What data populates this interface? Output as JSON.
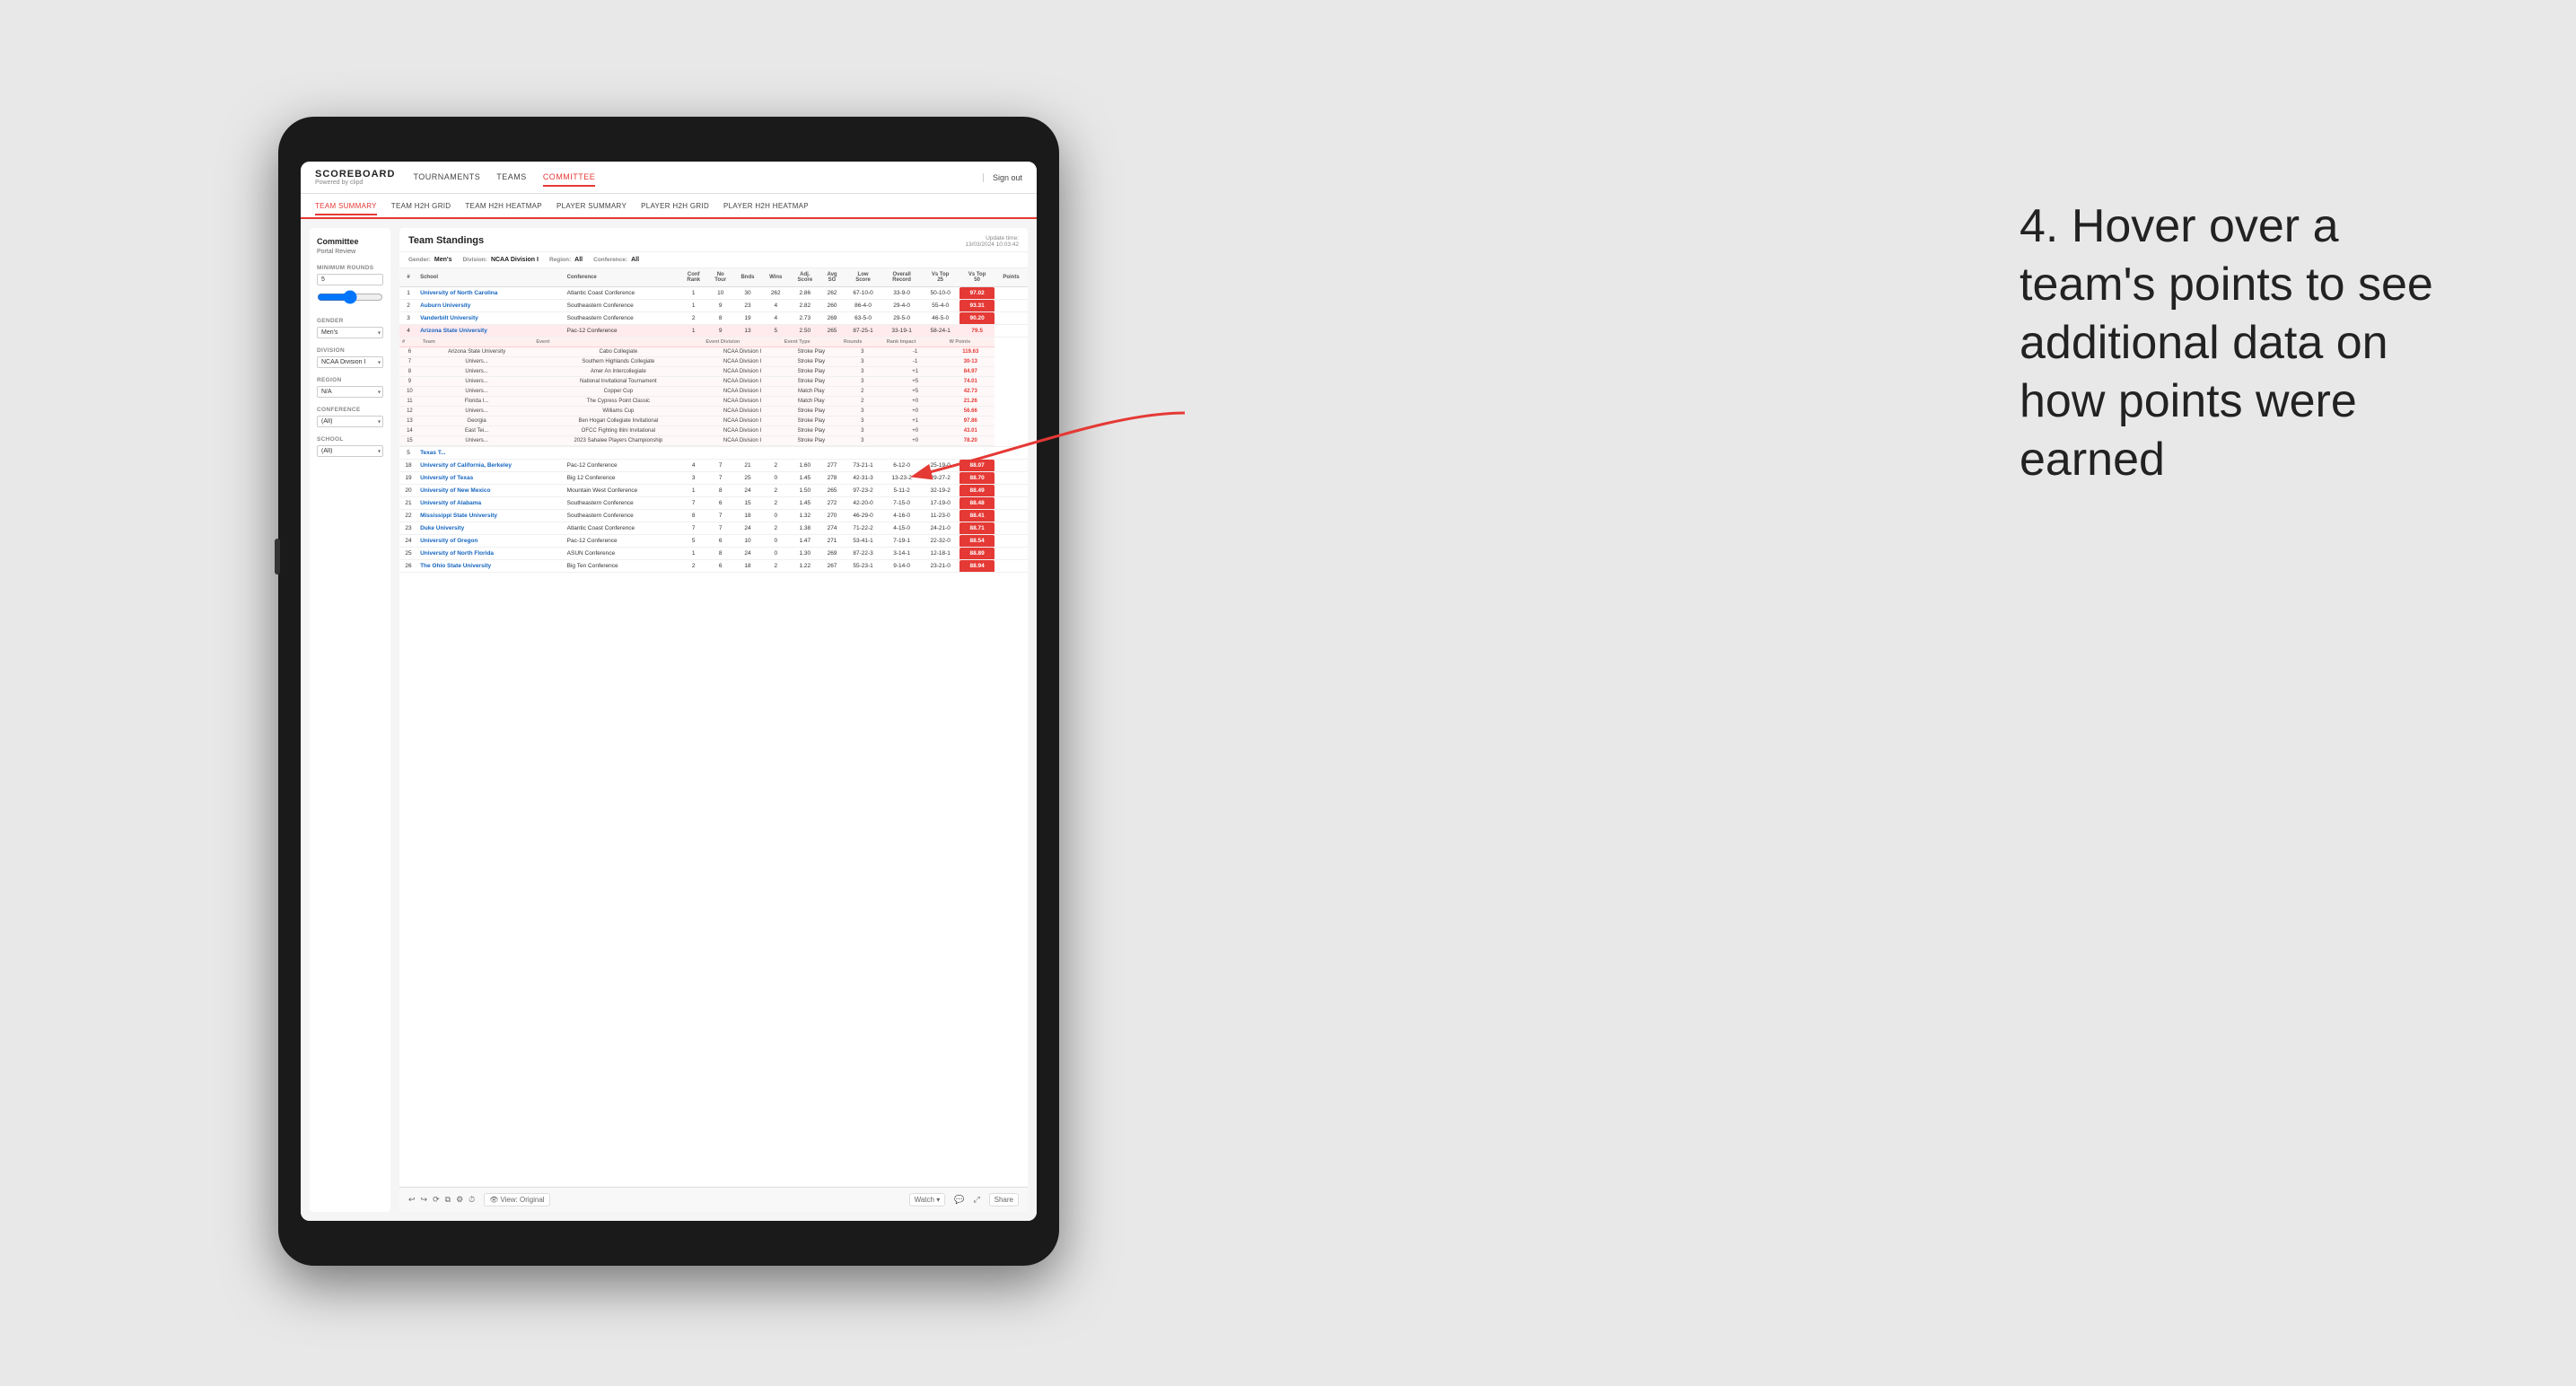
{
  "app": {
    "logo": "SCOREBOARD",
    "logo_sub": "Powered by clipd",
    "sign_out": "Sign out"
  },
  "nav": {
    "items": [
      {
        "label": "TOURNAMENTS",
        "active": false
      },
      {
        "label": "TEAMS",
        "active": false
      },
      {
        "label": "COMMITTEE",
        "active": true
      }
    ]
  },
  "subnav": {
    "items": [
      {
        "label": "TEAM SUMMARY",
        "active": true
      },
      {
        "label": "TEAM H2H GRID",
        "active": false
      },
      {
        "label": "TEAM H2H HEATMAP",
        "active": false
      },
      {
        "label": "PLAYER SUMMARY",
        "active": false
      },
      {
        "label": "PLAYER H2H GRID",
        "active": false
      },
      {
        "label": "PLAYER H2H HEATMAP",
        "active": false
      }
    ]
  },
  "sidebar": {
    "header": "Committee",
    "subheader": "Portal Review",
    "min_rounds_label": "Minimum Rounds",
    "min_rounds_value": "5",
    "gender_label": "Gender",
    "gender_value": "Men's",
    "division_label": "Division",
    "division_value": "NCAA Division I",
    "region_label": "Region",
    "region_value": "N/A",
    "conference_label": "Conference",
    "conference_value": "(All)",
    "school_label": "School",
    "school_value": "(All)"
  },
  "standings": {
    "title": "Team Standings",
    "update_time_label": "Update time:",
    "update_time": "13/03/2024 10:03:42",
    "filters": {
      "gender_label": "Gender:",
      "gender_value": "Men's",
      "division_label": "Division:",
      "division_value": "NCAA Division I",
      "region_label": "Region:",
      "region_value": "All",
      "conference_label": "Conference:",
      "conference_value": "All"
    },
    "columns": [
      "#",
      "School",
      "Conference",
      "Conf Rank",
      "No Tour",
      "Bnds",
      "Wins",
      "Adj. Score",
      "Avg SG",
      "Low Score",
      "Overall Record",
      "Vs Top 25",
      "Vs Top 50",
      "Points"
    ],
    "rows": [
      {
        "rank": 1,
        "school": "University of North Carolina",
        "conf": "Atlantic Coast Conference",
        "conf_rank": 1,
        "no_tour": 10,
        "bnds": 30,
        "wins": 262,
        "adj_score": 2.86,
        "avg_sg": 262,
        "low_score": "67-10-0",
        "vs_top25": "33-9-0",
        "vs_top50": "50-10-0",
        "points": "97.02",
        "highlighted": false
      },
      {
        "rank": 2,
        "school": "Auburn University",
        "conf": "Southeastern Conference",
        "conf_rank": 1,
        "no_tour": 9,
        "bnds": 23,
        "wins": 4,
        "adj_score": 2.82,
        "avg_sg": 260,
        "low_score": "86-4-0",
        "vs_top25": "29-4-0",
        "vs_top50": "55-4-0",
        "points": "93.31",
        "highlighted": false
      },
      {
        "rank": 3,
        "school": "Vanderbilt University",
        "conf": "Southeastern Conference",
        "conf_rank": 2,
        "no_tour": 8,
        "bnds": 19,
        "wins": 4,
        "adj_score": 2.73,
        "avg_sg": 269,
        "low_score": "63-5-0",
        "vs_top25": "29-5-0",
        "vs_top50": "46-5-0",
        "points": "90.20",
        "highlighted": false
      },
      {
        "rank": 4,
        "school": "Arizona State University",
        "conf": "Pac-12 Conference",
        "conf_rank": 1,
        "no_tour": 9,
        "bnds": 13,
        "wins": 5,
        "adj_score": 2.5,
        "avg_sg": 265,
        "low_score": "87-25-1",
        "vs_top25": "33-19-1",
        "vs_top50": "58-24-1",
        "points": "79.5",
        "highlighted": true
      },
      {
        "rank": 5,
        "school": "Texas T...",
        "conf": "",
        "conf_rank": "",
        "no_tour": "",
        "bnds": "",
        "wins": "",
        "adj_score": "",
        "avg_sg": "",
        "low_score": "",
        "vs_top25": "",
        "vs_top50": "",
        "points": "",
        "highlighted": false
      }
    ],
    "tooltip_header": [
      "Team",
      "Event",
      "Event Division",
      "Event Type",
      "Rounds",
      "Rank Impact",
      "W Points"
    ],
    "tooltip_rows": [
      {
        "team": "Arizona State University",
        "event": "Cabo Collegiate",
        "event_division": "NCAA Division I",
        "event_type": "Stroke Play",
        "rounds": 3,
        "rank_impact": "-1",
        "w_points": "119.63"
      },
      {
        "team": "Univers...",
        "event": "Southern Highlands Collegiate",
        "event_division": "NCAA Division I",
        "event_type": "Stroke Play",
        "rounds": 3,
        "rank_impact": "-1",
        "w_points": "30-13"
      },
      {
        "team": "Univers...",
        "event": "Amer An Intercollegiate",
        "event_division": "NCAA Division I",
        "event_type": "Stroke Play",
        "rounds": 3,
        "rank_impact": "+1",
        "w_points": "84.97"
      },
      {
        "team": "Univers...",
        "event": "National Invitational Tournament",
        "event_division": "NCAA Division I",
        "event_type": "Stroke Play",
        "rounds": 3,
        "rank_impact": "+5",
        "w_points": "74.01"
      },
      {
        "team": "Univers...",
        "event": "Copper Cup",
        "event_division": "NCAA Division I",
        "event_type": "Match Play",
        "rounds": 2,
        "rank_impact": "+5",
        "w_points": "42.73"
      },
      {
        "team": "Florida I...",
        "event": "The Cypress Point Classic",
        "event_division": "NCAA Division I",
        "event_type": "Match Play",
        "rounds": 2,
        "rank_impact": "+0",
        "w_points": "21.26"
      },
      {
        "team": "Univers...",
        "event": "Williams Cup",
        "event_division": "NCAA Division I",
        "event_type": "Stroke Play",
        "rounds": 3,
        "rank_impact": "+0",
        "w_points": "56.66"
      },
      {
        "team": "Georgia",
        "event": "Ben Hogan Collegiate Invitational",
        "event_division": "NCAA Division I",
        "event_type": "Stroke Play",
        "rounds": 3,
        "rank_impact": "+1",
        "w_points": "97.86"
      },
      {
        "team": "East Tei...",
        "event": "OFCC Fighting Illini Invitational",
        "event_division": "NCAA Division I",
        "event_type": "Stroke Play",
        "rounds": 3,
        "rank_impact": "+0",
        "w_points": "43.01"
      },
      {
        "team": "Univers...",
        "event": "2023 Sahalee Players Championship",
        "event_division": "NCAA Division I",
        "event_type": "Stroke Play",
        "rounds": 3,
        "rank_impact": "+0",
        "w_points": "78.20"
      }
    ],
    "lower_rows": [
      {
        "rank": 18,
        "school": "University of California, Berkeley",
        "conf": "Pac-12 Conference",
        "conf_rank": 4,
        "no_tour": 7,
        "bnds": 21,
        "wins": 2,
        "adj_score": 1.6,
        "avg_sg": 277,
        "low_score": "73-21-1",
        "vs_top25": "6-12-0",
        "vs_top50": "25-19-0",
        "points": "88.07"
      },
      {
        "rank": 19,
        "school": "University of Texas",
        "conf": "Big 12 Conference",
        "conf_rank": 3,
        "no_tour": 7,
        "bnds": 25,
        "wins": 0,
        "adj_score": 1.45,
        "avg_sg": 278,
        "low_score": "42-31-3",
        "vs_top25": "13-23-2",
        "vs_top50": "29-27-2",
        "points": "88.70"
      },
      {
        "rank": 20,
        "school": "University of New Mexico",
        "conf": "Mountain West Conference",
        "conf_rank": 1,
        "no_tour": 8,
        "bnds": 24,
        "wins": 2,
        "adj_score": 1.5,
        "avg_sg": 265,
        "low_score": "97-23-2",
        "vs_top25": "5-11-2",
        "vs_top50": "32-19-2",
        "points": "88.49"
      },
      {
        "rank": 21,
        "school": "University of Alabama",
        "conf": "Southeastern Conference",
        "conf_rank": 7,
        "no_tour": 6,
        "bnds": 15,
        "wins": 2,
        "adj_score": 1.45,
        "avg_sg": 272,
        "low_score": "42-20-0",
        "vs_top25": "7-15-0",
        "vs_top50": "17-19-0",
        "points": "88.48"
      },
      {
        "rank": 22,
        "school": "Mississippi State University",
        "conf": "Southeastern Conference",
        "conf_rank": 8,
        "no_tour": 7,
        "bnds": 18,
        "wins": 0,
        "adj_score": 1.32,
        "avg_sg": 270,
        "low_score": "46-29-0",
        "vs_top25": "4-16-0",
        "vs_top50": "11-23-0",
        "points": "88.41"
      },
      {
        "rank": 23,
        "school": "Duke University",
        "conf": "Atlantic Coast Conference",
        "conf_rank": 7,
        "no_tour": 7,
        "bnds": 24,
        "wins": 2,
        "adj_score": 1.38,
        "avg_sg": 274,
        "low_score": "71-22-2",
        "vs_top25": "4-15-0",
        "vs_top50": "24-21-0",
        "points": "88.71"
      },
      {
        "rank": 24,
        "school": "University of Oregon",
        "conf": "Pac-12 Conference",
        "conf_rank": 5,
        "no_tour": 6,
        "bnds": 10,
        "wins": 0,
        "adj_score": 1.47,
        "avg_sg": 271,
        "low_score": "53-41-1",
        "vs_top25": "7-19-1",
        "vs_top50": "22-32-0",
        "points": "88.54"
      },
      {
        "rank": 25,
        "school": "University of North Florida",
        "conf": "ASUN Conference",
        "conf_rank": 1,
        "no_tour": 8,
        "bnds": 24,
        "wins": 0,
        "adj_score": 1.3,
        "avg_sg": 269,
        "low_score": "87-22-3",
        "vs_top25": "3-14-1",
        "vs_top50": "12-18-1",
        "points": "88.89"
      },
      {
        "rank": 26,
        "school": "The Ohio State University",
        "conf": "Big Ten Conference",
        "conf_rank": 2,
        "no_tour": 6,
        "bnds": 18,
        "wins": 2,
        "adj_score": 1.22,
        "avg_sg": 267,
        "low_score": "55-23-1",
        "vs_top25": "9-14-0",
        "vs_top50": "23-21-0",
        "points": "88.94"
      }
    ]
  },
  "toolbar": {
    "view_label": "View: Original",
    "watch_label": "Watch ▾",
    "share_label": "Share"
  },
  "annotation": {
    "text": "4. Hover over a team's points to see additional data on how points were earned"
  }
}
